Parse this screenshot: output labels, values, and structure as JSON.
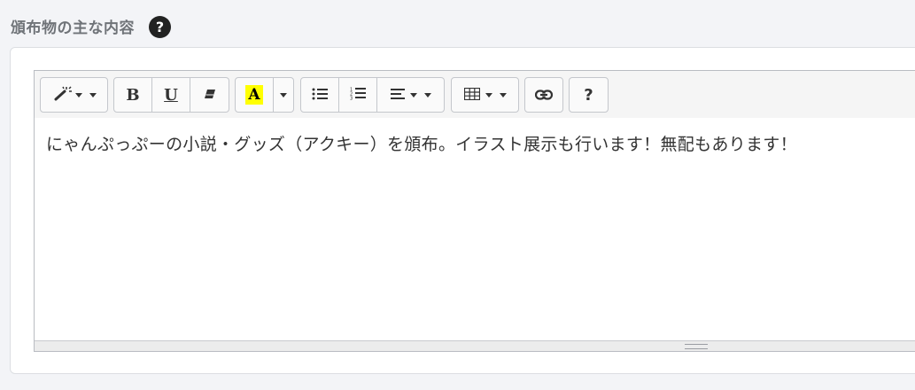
{
  "section": {
    "title": "頒布物の主な内容",
    "help_icon_label": "?"
  },
  "toolbar": {
    "style_icon": "magic-wand-icon",
    "bold_label": "B",
    "underline_label": "U",
    "eraser_icon": "eraser-icon",
    "color_label": "A",
    "highlight_color": "#ffff00",
    "ul_icon": "unordered-list-icon",
    "ol_icon": "ordered-list-icon",
    "align_icon": "align-left-icon",
    "table_icon": "table-icon",
    "link_icon": "link-icon",
    "help_label": "?"
  },
  "editor": {
    "content": "にゃんぷっぷーの小説・グッズ（アクキー）を頒布。イラスト展示も行います！無配もあります！"
  }
}
